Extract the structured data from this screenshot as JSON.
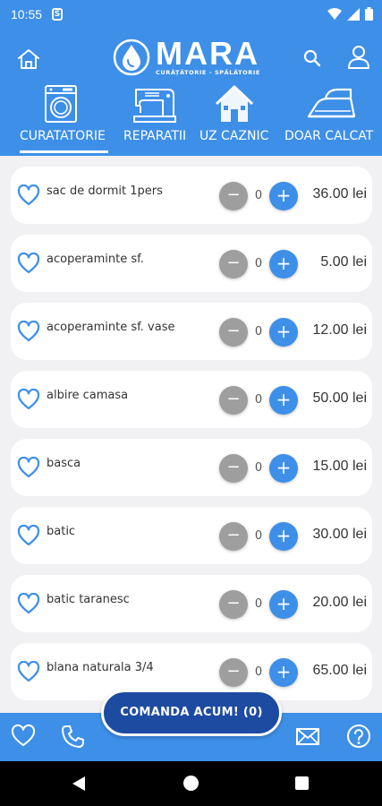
{
  "status": {
    "time": "10:55",
    "s_badge": "S"
  },
  "header": {
    "logo_name": "MARA",
    "logo_sub": "CURĂȚĂTORIE - SPĂLĂTORIE"
  },
  "categories": [
    {
      "label": "CURATATORIE",
      "icon": "washing-machine-icon",
      "active": true
    },
    {
      "label": "REPARATII",
      "icon": "sewing-machine-icon",
      "active": false
    },
    {
      "label": "UZ CAZNIC",
      "icon": "house-icon",
      "active": false
    },
    {
      "label": "DOAR CALCAT",
      "icon": "iron-icon",
      "active": false
    }
  ],
  "items": [
    {
      "name": "sac de dormit 1pers",
      "qty": "0",
      "price": "36.00 lei"
    },
    {
      "name": "acoperaminte sf.",
      "qty": "0",
      "price": "5.00 lei"
    },
    {
      "name": "acoperaminte sf. vase",
      "qty": "0",
      "price": "12.00 lei"
    },
    {
      "name": "albire camasa",
      "qty": "0",
      "price": "50.00 lei"
    },
    {
      "name": "basca",
      "qty": "0",
      "price": "15.00 lei"
    },
    {
      "name": "batic",
      "qty": "0",
      "price": "30.00 lei"
    },
    {
      "name": "batic taranesc",
      "qty": "0",
      "price": "20.00 lei"
    },
    {
      "name": "blana naturala 3/4",
      "qty": "0",
      "price": "65.00 lei"
    }
  ],
  "buttons": {
    "minus": "−",
    "plus": "+"
  },
  "order_button": "COMANDA ACUM! (0)",
  "colors": {
    "primary": "#3d8fe8",
    "order_button": "#1d4ba1",
    "minus_button": "#9e9e9e",
    "background": "#f1f1f3"
  }
}
